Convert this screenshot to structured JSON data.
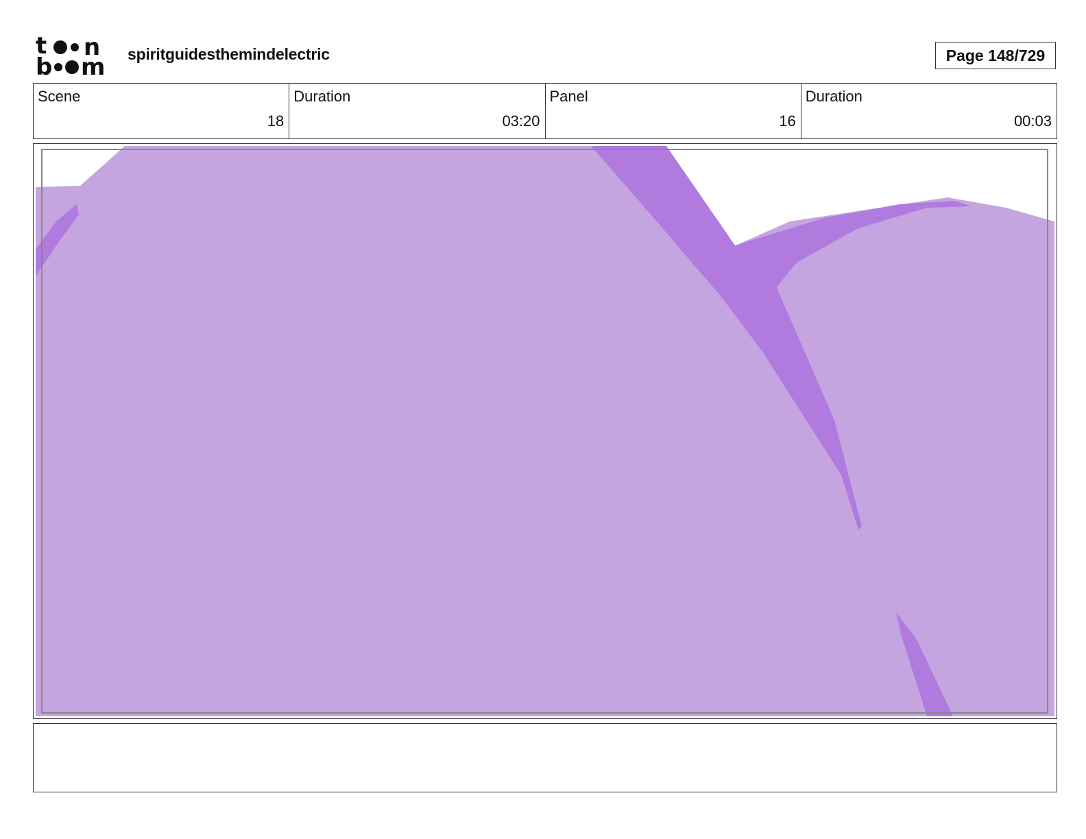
{
  "header": {
    "logo_text": "toonboom",
    "project_title": "spiritguidesthemindelectric",
    "page_label": "Page 148/729"
  },
  "info": {
    "scene_label": "Scene",
    "scene_value": "18",
    "scene_duration_label": "Duration",
    "scene_duration_value": "03:20",
    "panel_label": "Panel",
    "panel_value": "16",
    "panel_duration_label": "Duration",
    "panel_duration_value": "00:03"
  },
  "panel": {
    "fill_color": "#c4a5e0",
    "stroke_color": "#b07ade"
  },
  "notes": {
    "text": ""
  }
}
